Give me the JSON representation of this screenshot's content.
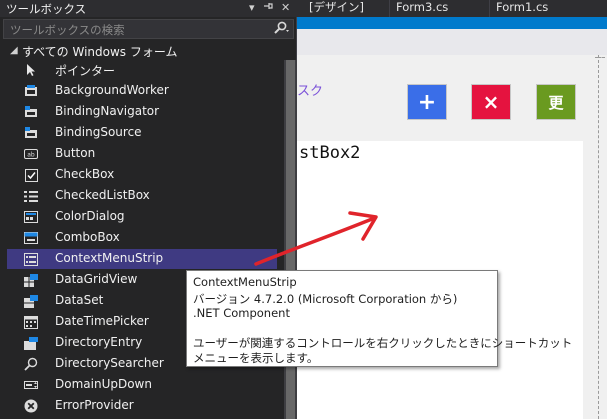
{
  "editor_tabs": [
    {
      "label": "[デザイン]"
    },
    {
      "label": "Form3.cs"
    },
    {
      "label": "Form1.cs"
    }
  ],
  "toolbox": {
    "title": "ツールボックス",
    "search_placeholder": "ツールボックスの検索",
    "group_label": "すべての Windows フォーム",
    "items": [
      {
        "label": "ポインター",
        "icon": "pointer-icon"
      },
      {
        "label": "BackgroundWorker",
        "icon": "background-worker-icon"
      },
      {
        "label": "BindingNavigator",
        "icon": "binding-navigator-icon"
      },
      {
        "label": "BindingSource",
        "icon": "binding-source-icon"
      },
      {
        "label": "Button",
        "icon": "button-icon"
      },
      {
        "label": "CheckBox",
        "icon": "checkbox-icon"
      },
      {
        "label": "CheckedListBox",
        "icon": "checked-list-box-icon"
      },
      {
        "label": "ColorDialog",
        "icon": "color-dialog-icon"
      },
      {
        "label": "ComboBox",
        "icon": "combo-box-icon"
      },
      {
        "label": "ContextMenuStrip",
        "icon": "context-menu-strip-icon",
        "selected": true
      },
      {
        "label": "DataGridView",
        "icon": "data-grid-view-icon"
      },
      {
        "label": "DataSet",
        "icon": "data-set-icon"
      },
      {
        "label": "DateTimePicker",
        "icon": "date-time-picker-icon"
      },
      {
        "label": "DirectoryEntry",
        "icon": "directory-entry-icon"
      },
      {
        "label": "DirectorySearcher",
        "icon": "directory-searcher-icon"
      },
      {
        "label": "DomainUpDown",
        "icon": "domain-up-down-icon"
      },
      {
        "label": "ErrorProvider",
        "icon": "error-provider-icon"
      }
    ]
  },
  "designer": {
    "link_text": "スク",
    "buttons": [
      {
        "label": "+",
        "color": "#3a6ee8"
      },
      {
        "label": "×",
        "color": "#e5133f"
      },
      {
        "label": "更",
        "color": "#6a9a20"
      }
    ],
    "listbox_text": "stBox2"
  },
  "tooltip": {
    "title": "ContextMenuStrip",
    "version": "バージョン 4.7.2.0 (Microsoft Corporation から)",
    "component": ".NET Component",
    "desc_line1": "ユーザーが関連するコントロールを右クリックしたときにショートカット",
    "desc_line2": "メニューを表示します。"
  },
  "colors": {
    "selection": "#3f3a82",
    "arrow": "#e0242b",
    "accent": "#007acc"
  }
}
